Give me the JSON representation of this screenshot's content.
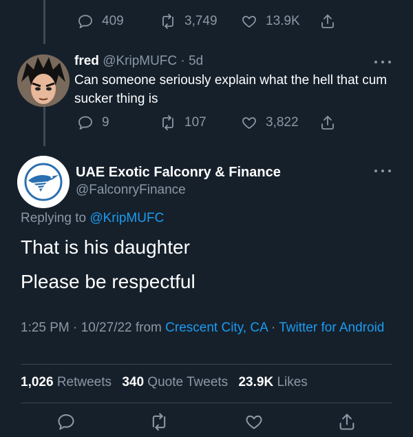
{
  "prev_tweet": {
    "replies": "409",
    "retweets": "3,749",
    "likes": "13.9K"
  },
  "reply_tweet": {
    "name": "fred",
    "handle": "@KripMUFC",
    "separator": "·",
    "time": "5d",
    "text": "Can someone seriously explain what the hell that cum sucker thing is",
    "replies": "9",
    "retweets": "107",
    "likes": "3,822"
  },
  "main_tweet": {
    "name": "UAE Exotic Falconry & Finance",
    "handle": "@FalconryFinance",
    "replying_prefix": "Replying to",
    "replying_handle": "@KripMUFC",
    "line1": "That is his daughter",
    "line2": "Please be respectful",
    "timestamp": "1:25 PM · 10/27/22 from",
    "location": "Crescent City, CA",
    "sep": "·",
    "source": "Twitter for Android",
    "retweets_count": "1,026",
    "retweets_label": "Retweets",
    "quotes_count": "340",
    "quotes_label": "Quote Tweets",
    "likes_count": "23.9K",
    "likes_label": "Likes"
  },
  "colors": {
    "background": "#15202b",
    "muted": "#8b98a5",
    "link": "#1d9bf0",
    "divider": "#38444d"
  }
}
